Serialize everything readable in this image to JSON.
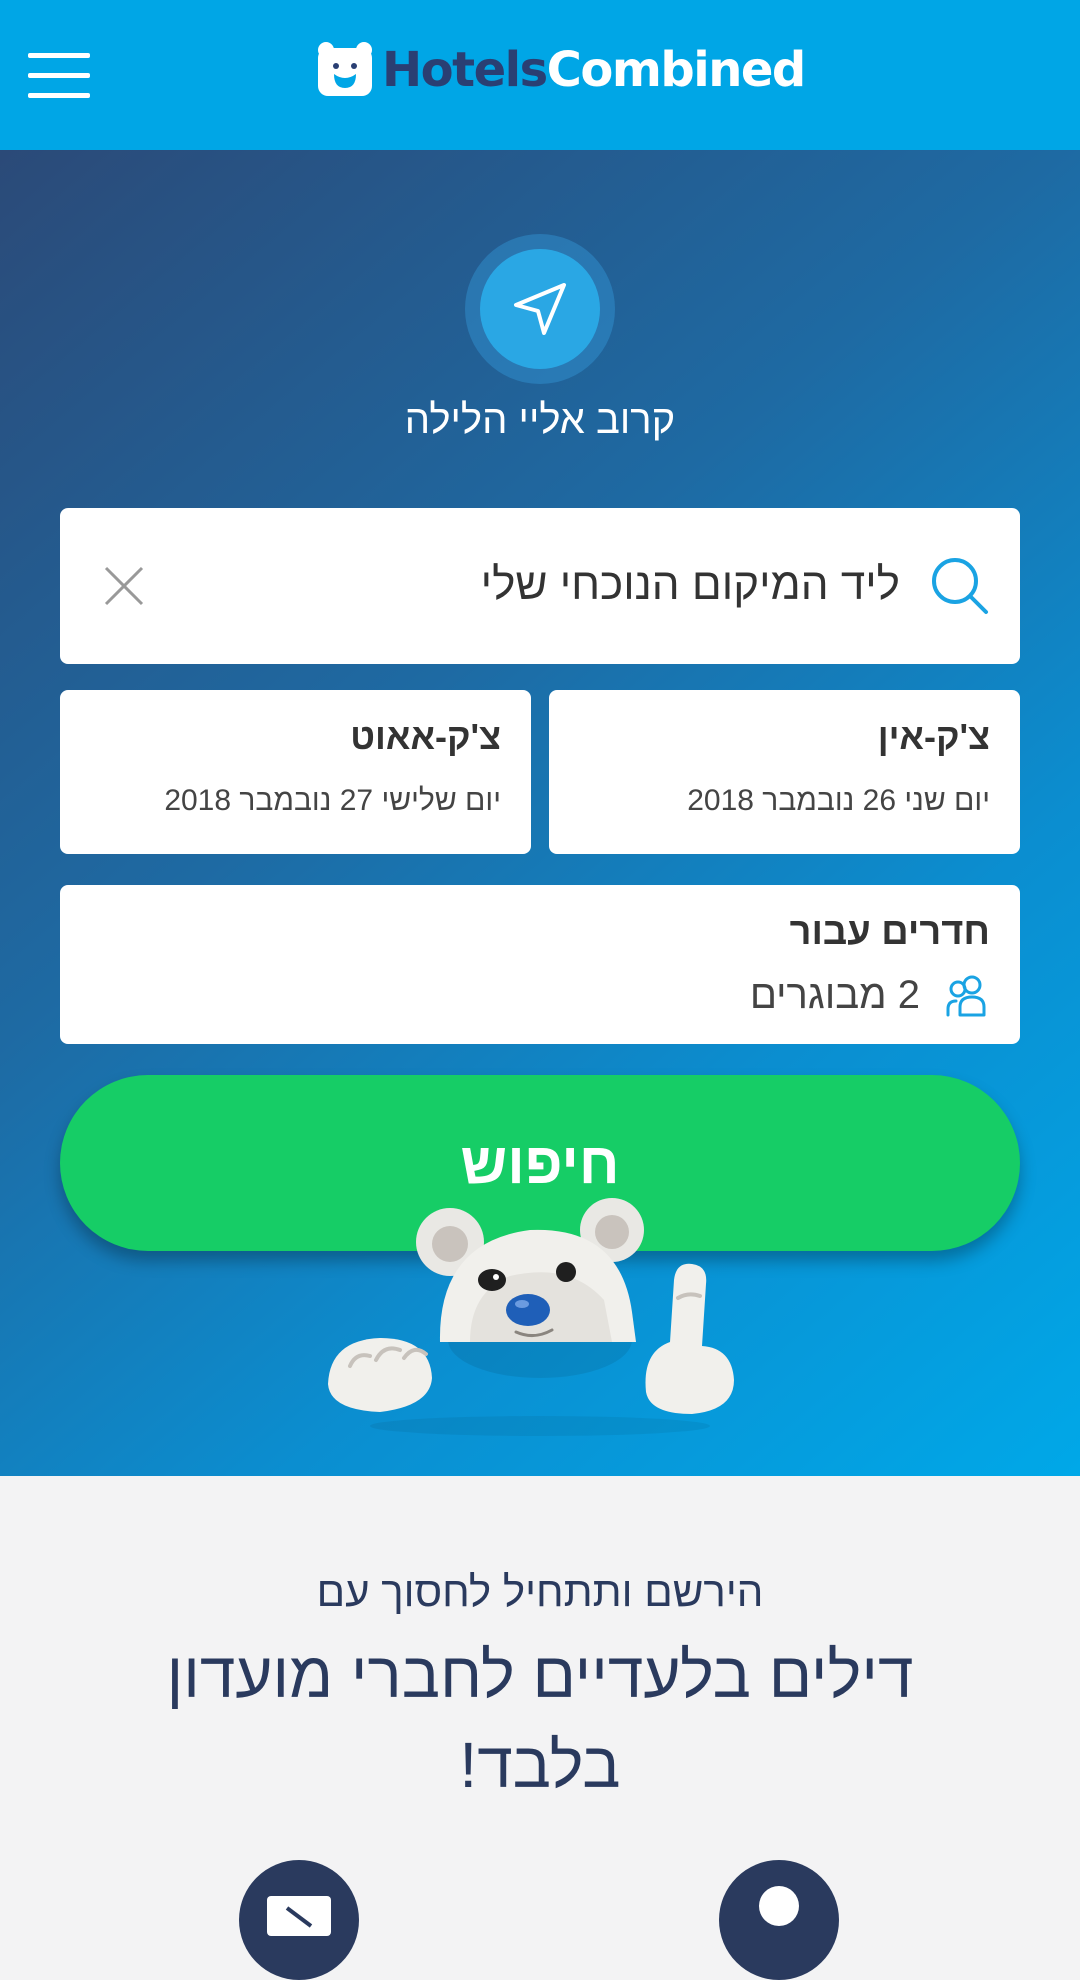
{
  "header": {
    "logo_part1": "Hotels",
    "logo_part2": "Combined",
    "menu_icon": "hamburger-menu-icon",
    "brand_color": "#00a6e6"
  },
  "hero": {
    "locate_icon": "navigation-arrow-icon",
    "near_me_label": "קרוב אליי הלילה"
  },
  "search": {
    "value": "ליד המיקום הנוכחי שלי",
    "search_icon": "search-icon",
    "clear_icon": "close-icon"
  },
  "dates": {
    "checkin_label": "צ'ק-אין",
    "checkin_value": "יום שני 26 נובמבר 2018",
    "checkout_label": "צ'ק-אאוט",
    "checkout_value": "יום שלישי 27 נובמבר 2018"
  },
  "rooms": {
    "label": "חדרים עבור",
    "value": "2 מבוגרים",
    "icon": "people-icon"
  },
  "search_button": {
    "label": "חיפוש",
    "color": "#16cd66"
  },
  "promo": {
    "subtitle": "הירשם ותתחיל לחסוך עם",
    "title": "דילים בלעדיים לחברי מועדון בלבד!"
  }
}
